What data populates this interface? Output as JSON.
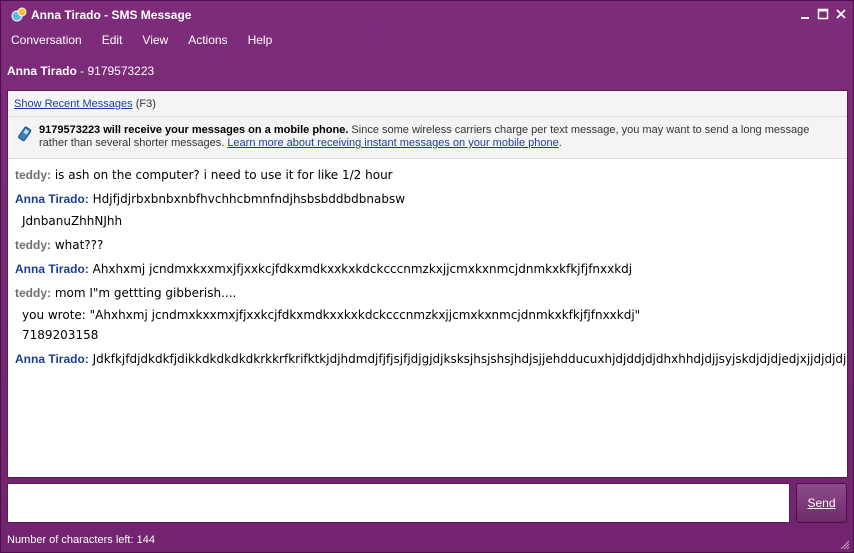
{
  "window": {
    "title": "Anna Tirado - SMS Message",
    "controls": [
      "minimize",
      "maximize",
      "close"
    ]
  },
  "menu": {
    "items": [
      "Conversation",
      "Edit",
      "View",
      "Actions",
      "Help"
    ]
  },
  "contact": {
    "name": "Anna Tirado",
    "separator": " - ",
    "number": "9179573223"
  },
  "recent": {
    "link": "Show Recent Messages",
    "shortcut": "(F3)"
  },
  "notice": {
    "bold": "9179573223 will receive your messages on a mobile phone.",
    "text": " Since some wireless carriers charge per text message, you may want to send a long message rather than several shorter messages. ",
    "link": "Learn more about receiving instant messages on your mobile phone",
    "end": "."
  },
  "messages": [
    {
      "sender": "teddy:",
      "who": "teddy",
      "lines": [
        "is ash on the computer? i need to use it for like 1/2 hour"
      ]
    },
    {
      "sender": "Anna Tirado:",
      "who": "anna",
      "lines": [
        "Hdjfjdjrbxbnbxnbfhvchhcbmnfndjhsbsbddbdbnabsw",
        "JdnbanuZhhNJhh"
      ]
    },
    {
      "sender": "teddy:",
      "who": "teddy",
      "lines": [
        "what???"
      ]
    },
    {
      "sender": "Anna Tirado:",
      "who": "anna",
      "lines": [
        "Ahxhxmj jcndmxkxxmxjfjxxkcjfdkxmdkxxkxkdckcccnmzkxjjcmxkxnmcjdnmkxkfkjfjfnxxkdj"
      ]
    },
    {
      "sender": "teddy:",
      "who": "teddy",
      "lines": [
        "mom I\"m gettting gibberish....",
        "you wrote: \"Ahxhxmj jcndmxkxxmxjfjxxkcjfdkxmdkxxkxkdckcccnmzkxjjcmxkxnmcjdnmkxkfkjfjfnxxkdj\"",
        "7189203158"
      ]
    },
    {
      "sender": "Anna Tirado:",
      "who": "anna",
      "lines": [
        "Jdkfkjfdjdkdkfjdikkdkdkdkdkrkkrfkrifktkjdjhdmdjfjfjsjfjdjgjdjksksjhsjshsjhdjsjjehdducuxhjdjddjdjdhxhhdjdjjsyjskdjdjdjedjxjjdjdjdjsididdj"
      ]
    }
  ],
  "input": {
    "value": "",
    "send_label": "Send"
  },
  "status": {
    "text": "Number of characters left: 144"
  },
  "colors": {
    "window_bg": "#7a2a76",
    "teddy_name": "#6f6f6f",
    "anna_name": "#1d3f8f",
    "link": "#1a3fa3"
  }
}
